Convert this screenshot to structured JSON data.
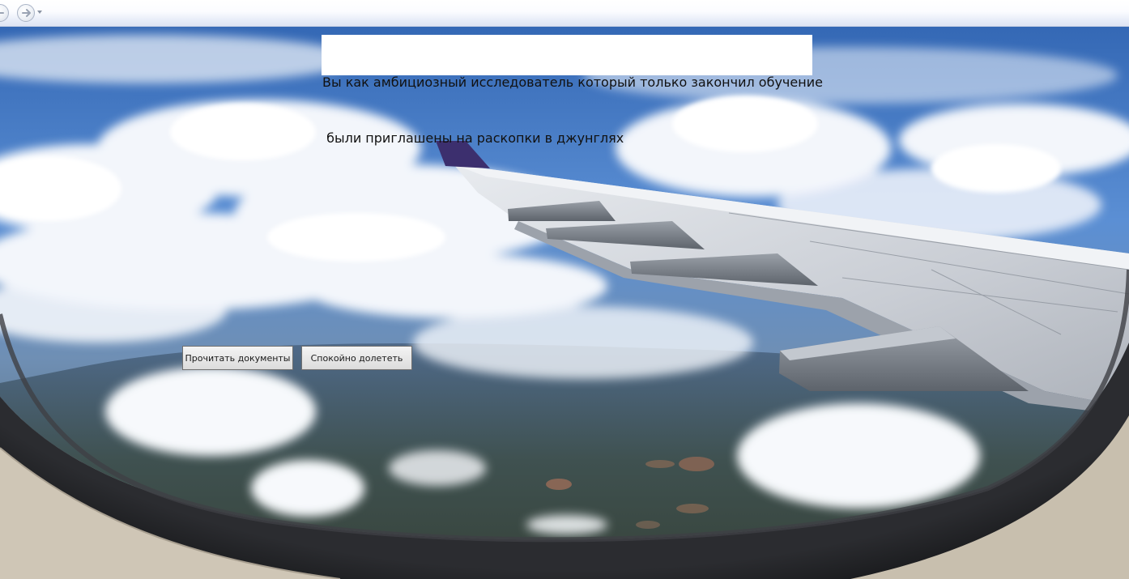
{
  "navigation": {
    "back_icon": "arrow-left-icon",
    "forward_icon": "arrow-right-icon",
    "history_icon": "chevron-down-icon"
  },
  "story": {
    "lines": [
      "Вы как амбициозный исследователь который только закончил обучение",
      " были приглашены на раскопки в джунглях"
    ]
  },
  "choices": {
    "read_documents": "Прочитать документы",
    "fly_calmly": "Спокойно долететь"
  },
  "colors": {
    "sky": "#3f78c8",
    "cloud": "#f2f5fa",
    "window_frame": "#1c1d20",
    "wing": "#d9dde3",
    "tail": "#3c2f6e"
  }
}
